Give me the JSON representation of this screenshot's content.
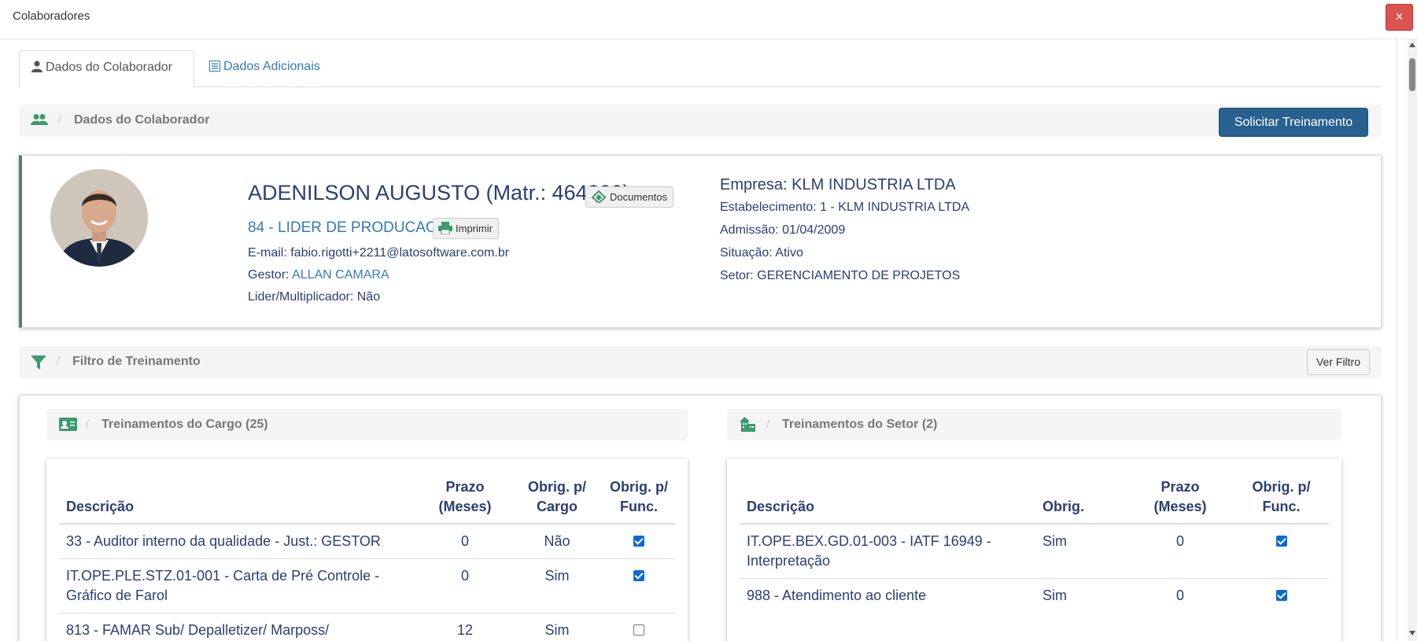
{
  "window": {
    "title": "Colaboradores",
    "close_label": "×"
  },
  "tabs": [
    {
      "label": "Dados do Colaborador",
      "icon": "user-icon",
      "active": true
    },
    {
      "label": "Dados Adicionais",
      "icon": "list-alt-icon",
      "active": false
    }
  ],
  "collaborator_bar": {
    "title": "Dados do Colaborador",
    "action_label": "Solicitar Treinamento"
  },
  "profile": {
    "name": "ADENILSON AUGUSTO (Matr.: 464200)",
    "documents_label": "Documentos",
    "role": "84 - LIDER DE PRODUCAO II",
    "print_label": "Imprimir",
    "email_label": "E-mail:",
    "email": "fabio.rigotti+2211@latosoftware.com.br",
    "manager_label": "Gestor:",
    "manager": "ALLAN CAMARA",
    "leader_label": "Lider/Multiplicador:",
    "leader": "Não",
    "company": "Empresa: KLM INDUSTRIA LTDA",
    "establishment": "Estabelecimento: 1 - KLM INDUSTRIA LTDA",
    "admission": "Admissão: 01/04/2009",
    "status": "Situação: Ativo",
    "sector": "Setor: GERENCIAMENTO DE PROJETOS"
  },
  "filter_bar": {
    "title": "Filtro de Treinamento",
    "action_label": "Ver Filtro"
  },
  "cargo_trainings": {
    "title": "Treinamentos do Cargo (25)",
    "columns": {
      "description": "Descrição",
      "deadline_1": "Prazo",
      "deadline_2": "(Meses)",
      "required_role_1": "Obrig. p/",
      "required_role_2": "Cargo",
      "required_func_1": "Obrig. p/",
      "required_func_2": "Func."
    },
    "rows": [
      {
        "description": "33 - Auditor interno da qualidade - Just.: GESTOR",
        "deadline": "0",
        "required_role": "Não",
        "required_func": true
      },
      {
        "description": "IT.OPE.PLE.STZ.01-001 - Carta de Pré Controle - Gráfico de Farol",
        "deadline": "0",
        "required_role": "Sim",
        "required_func": true
      },
      {
        "description": "813 - FAMAR Sub/ Depalletizer/ Marposs/",
        "deadline": "12",
        "required_role": "Sim",
        "required_func": false
      }
    ]
  },
  "sector_trainings": {
    "title": "Treinamentos do Setor (2)",
    "columns": {
      "description": "Descrição",
      "required": "Obrig.",
      "deadline_1": "Prazo",
      "deadline_2": "(Meses)",
      "required_func_1": "Obrig. p/",
      "required_func_2": "Func."
    },
    "rows": [
      {
        "description": "IT.OPE.BEX.GD.01-003 - IATF 16949 - Interpretação",
        "required": "Sim",
        "deadline": "0",
        "required_func": true
      },
      {
        "description": "988 - Atendimento ao cliente",
        "required": "Sim",
        "deadline": "0",
        "required_func": true
      }
    ]
  },
  "colors": {
    "primary": "#286090",
    "link": "#337ab7",
    "text": "#2c3e73",
    "icon_green": "#3d9970",
    "close_red": "#d9534f",
    "accent_border": "#5d7b6c"
  }
}
